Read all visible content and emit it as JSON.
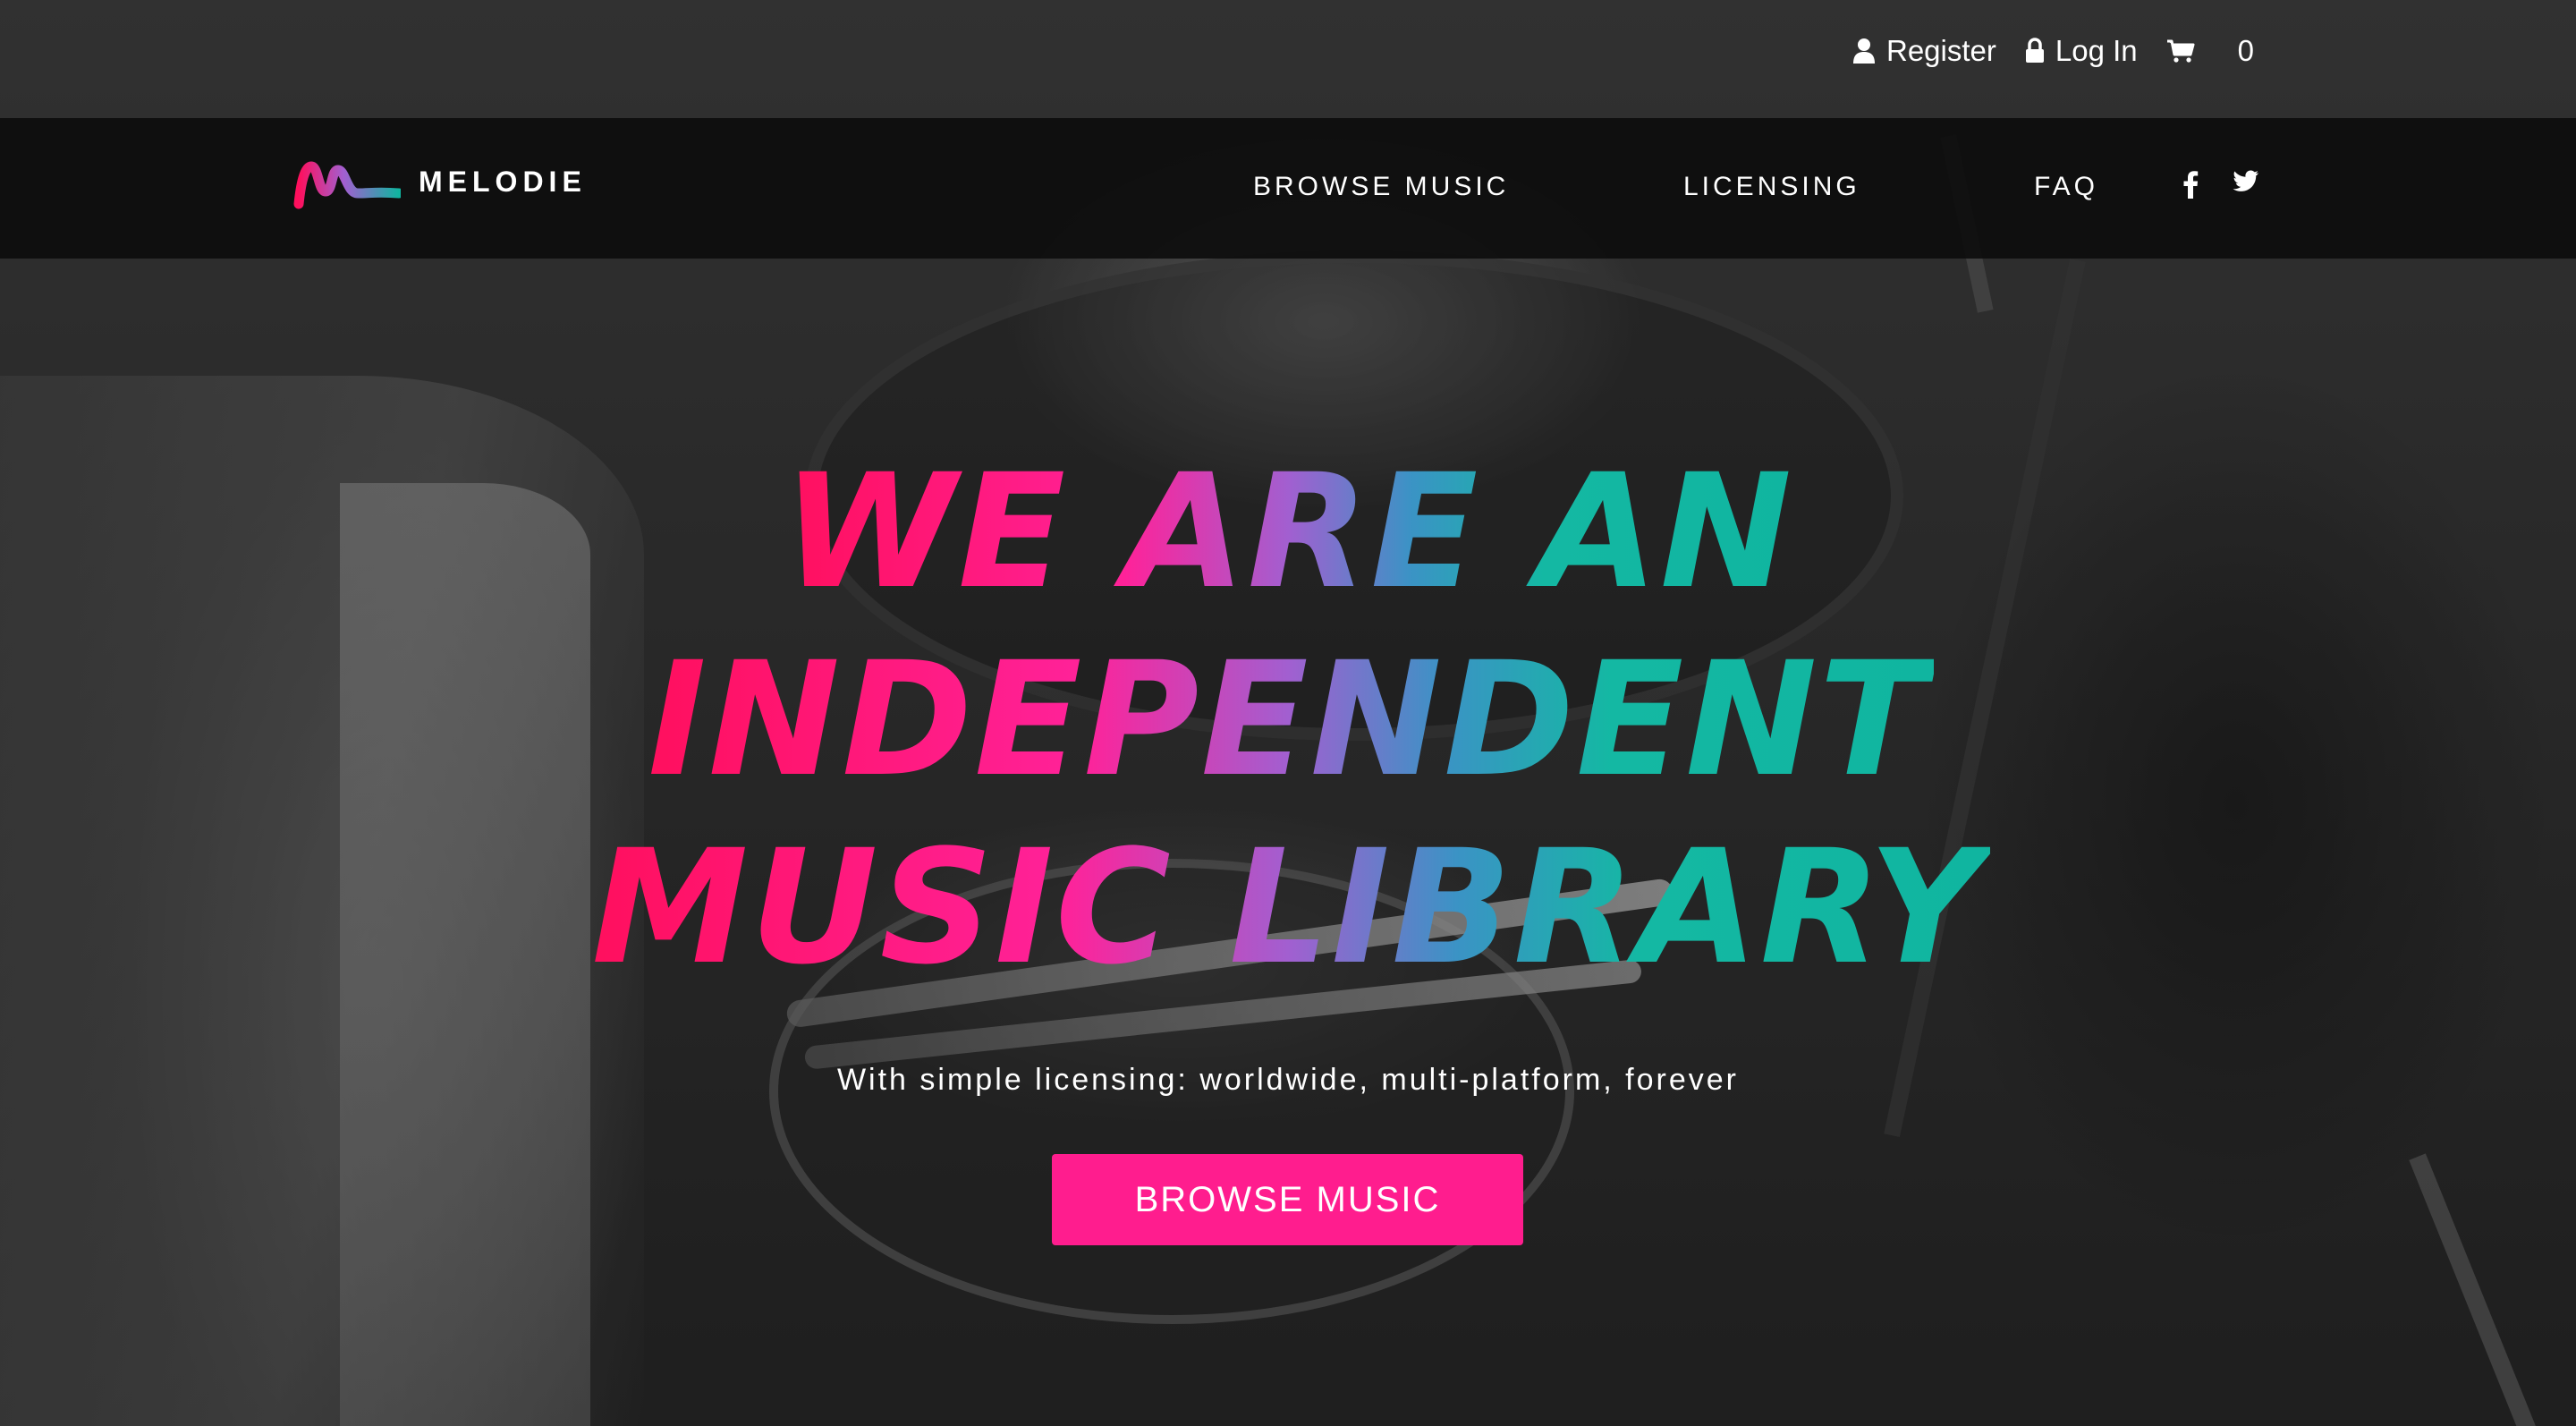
{
  "topbar": {
    "register_label": "Register",
    "login_label": "Log In",
    "cart_count": "0",
    "icons": [
      "user-icon",
      "lock-icon",
      "cart-icon"
    ]
  },
  "nav": {
    "logo_text": "MELODIE",
    "items": [
      {
        "label": "BROWSE MUSIC"
      },
      {
        "label": "LICENSING"
      },
      {
        "label": "FAQ"
      }
    ],
    "social_icons": [
      "facebook-icon",
      "twitter-icon"
    ]
  },
  "hero": {
    "title_lines": [
      "WE ARE AN",
      "INDEPENDENT",
      "MUSIC LIBRARY"
    ],
    "subtitle": "With simple licensing: worldwide, multi-platform, forever",
    "cta_label": "BROWSE MUSIC"
  },
  "colors": {
    "accent": "#ff1d8e",
    "gradient_start": "#ff0f5d",
    "gradient_mid": "#a25fd0",
    "gradient_end": "#10b5a0",
    "navbar_bg": "#0d0d0d"
  }
}
